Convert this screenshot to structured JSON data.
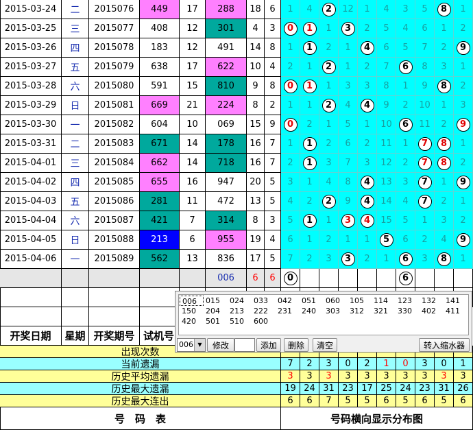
{
  "rows": [
    {
      "date": "2015-03-24",
      "wd": "二",
      "issue": "2015076",
      "trial": "449",
      "n1": "17",
      "draw": "288",
      "n2": "18",
      "n3": "6",
      "cells": [
        "1",
        "4",
        "2",
        "12",
        "1",
        "4",
        "3",
        "5",
        "8",
        "1"
      ],
      "balls": [
        2,
        8
      ]
    },
    {
      "date": "2015-03-25",
      "wd": "三",
      "issue": "2015077",
      "trial": "408",
      "n1": "12",
      "draw": "301",
      "n2": "4",
      "n3": "3",
      "cells": [
        "0",
        "1",
        "1",
        "3",
        "2",
        "5",
        "4",
        "6",
        "1",
        "2"
      ],
      "balls": [
        0,
        1,
        3
      ]
    },
    {
      "date": "2015-03-26",
      "wd": "四",
      "issue": "2015078",
      "trial": "183",
      "n1": "12",
      "draw": "491",
      "n2": "14",
      "n3": "8",
      "cells": [
        "1",
        "1",
        "2",
        "1",
        "4",
        "6",
        "5",
        "7",
        "2",
        "9"
      ],
      "balls": [
        1,
        4,
        9
      ]
    },
    {
      "date": "2015-03-27",
      "wd": "五",
      "issue": "2015079",
      "trial": "638",
      "n1": "17",
      "draw": "622",
      "n2": "10",
      "n3": "4",
      "cells": [
        "2",
        "1",
        "2",
        "1",
        "2",
        "7",
        "6",
        "8",
        "3",
        "1"
      ],
      "balls": [
        2,
        6
      ]
    },
    {
      "date": "2015-03-28",
      "wd": "六",
      "issue": "2015080",
      "trial": "591",
      "n1": "15",
      "draw": "810",
      "n2": "9",
      "n3": "8",
      "cells": [
        "0",
        "1",
        "1",
        "3",
        "3",
        "8",
        "1",
        "9",
        "8",
        "2"
      ],
      "balls": [
        0,
        1,
        8
      ]
    },
    {
      "date": "2015-03-29",
      "wd": "日",
      "issue": "2015081",
      "trial": "669",
      "n1": "21",
      "draw": "224",
      "n2": "8",
      "n3": "2",
      "cells": [
        "1",
        "1",
        "2",
        "4",
        "4",
        "9",
        "2",
        "10",
        "1",
        "3"
      ],
      "balls": [
        2,
        4
      ]
    },
    {
      "date": "2015-03-30",
      "wd": "一",
      "issue": "2015082",
      "trial": "604",
      "n1": "10",
      "draw": "069",
      "n2": "15",
      "n3": "9",
      "cells": [
        "0",
        "2",
        "1",
        "5",
        "1",
        "10",
        "6",
        "11",
        "2",
        "9"
      ],
      "balls": [
        0,
        6,
        9
      ]
    },
    {
      "date": "2015-03-31",
      "wd": "二",
      "issue": "2015083",
      "trial": "671",
      "n1": "14",
      "draw": "178",
      "n2": "16",
      "n3": "7",
      "cells": [
        "1",
        "1",
        "2",
        "6",
        "2",
        "11",
        "1",
        "7",
        "8",
        "1"
      ],
      "balls": [
        1,
        7,
        8
      ]
    },
    {
      "date": "2015-04-01",
      "wd": "三",
      "issue": "2015084",
      "trial": "662",
      "n1": "14",
      "draw": "718",
      "n2": "16",
      "n3": "7",
      "cells": [
        "2",
        "1",
        "3",
        "7",
        "3",
        "12",
        "2",
        "7",
        "8",
        "2"
      ],
      "balls": [
        1,
        7,
        8
      ]
    },
    {
      "date": "2015-04-02",
      "wd": "四",
      "issue": "2015085",
      "trial": "655",
      "n1": "16",
      "draw": "947",
      "n2": "20",
      "n3": "5",
      "cells": [
        "3",
        "1",
        "4",
        "8",
        "4",
        "13",
        "3",
        "7",
        "1",
        "9"
      ],
      "balls": [
        4,
        7,
        9
      ]
    },
    {
      "date": "2015-04-03",
      "wd": "五",
      "issue": "2015086",
      "trial": "281",
      "n1": "11",
      "draw": "472",
      "n2": "13",
      "n3": "5",
      "cells": [
        "4",
        "2",
        "2",
        "9",
        "4",
        "14",
        "4",
        "7",
        "2",
        "1"
      ],
      "balls": [
        2,
        4,
        7
      ]
    },
    {
      "date": "2015-04-04",
      "wd": "六",
      "issue": "2015087",
      "trial": "421",
      "n1": "7",
      "draw": "314",
      "n2": "8",
      "n3": "3",
      "cells": [
        "5",
        "1",
        "1",
        "3",
        "4",
        "15",
        "5",
        "1",
        "3",
        "2"
      ],
      "balls": [
        1,
        3,
        4
      ]
    },
    {
      "date": "2015-04-05",
      "wd": "日",
      "issue": "2015088",
      "trial": "213",
      "n1": "6",
      "draw": "955",
      "n2": "19",
      "n3": "4",
      "cells": [
        "6",
        "1",
        "2",
        "1",
        "1",
        "5",
        "6",
        "2",
        "4",
        "9"
      ],
      "balls": [
        5,
        9
      ]
    },
    {
      "date": "2015-04-06",
      "wd": "一",
      "issue": "2015089",
      "trial": "562",
      "n1": "13",
      "draw": "836",
      "n2": "17",
      "n3": "5",
      "cells": [
        "7",
        "2",
        "3",
        "3",
        "2",
        "1",
        "6",
        "3",
        "8",
        "1"
      ],
      "balls": [
        3,
        6,
        8
      ]
    }
  ],
  "trialStyles": [
    "magenta",
    "w",
    "w",
    "w",
    "w",
    "magenta",
    "w",
    "teal",
    "magenta",
    "magenta",
    "teal",
    "teal",
    "blue",
    "teal"
  ],
  "drawStyles": [
    "magenta",
    "teal",
    "w",
    "magenta",
    "teal",
    "magenta",
    "w",
    "teal",
    "teal",
    "w",
    "w",
    "teal",
    "magenta",
    "w"
  ],
  "redBalls": [
    [
      1,
      0
    ],
    [
      1,
      1
    ],
    [
      4,
      0
    ],
    [
      4,
      1
    ],
    [
      6,
      0
    ],
    [
      6,
      9
    ],
    [
      7,
      7
    ],
    [
      7,
      8
    ],
    [
      8,
      7
    ],
    [
      8,
      8
    ],
    [
      11,
      3
    ],
    [
      11,
      4
    ]
  ],
  "pending": {
    "draw": "006",
    "n2": "6",
    "n3": "6",
    "balls": [
      {
        "col": 0,
        "v": "0"
      },
      {
        "col": 6,
        "v": "6"
      }
    ]
  },
  "header": {
    "date": "开奖日期",
    "wd": "星期",
    "issue": "开奖期号",
    "trial": "试机号"
  },
  "stats": [
    {
      "label": "出现次数",
      "values": [
        "",
        "",
        "",
        "",
        "",
        "",
        "",
        "",
        "",
        ""
      ],
      "cls": "ylw"
    },
    {
      "label": "当前遗漏",
      "values": [
        "7",
        "2",
        "3",
        "0",
        "2",
        "1",
        "0",
        "3",
        "0",
        "1"
      ],
      "cls": "cyan2",
      "red": [
        5,
        6
      ]
    },
    {
      "label": "历史平均遗漏",
      "values": [
        "3",
        "3",
        "3",
        "3",
        "3",
        "3",
        "3",
        "3",
        "3",
        "3"
      ],
      "cls": "ylw",
      "red": [
        0,
        2,
        8
      ]
    },
    {
      "label": "历史最大遗漏",
      "values": [
        "19",
        "24",
        "31",
        "23",
        "17",
        "25",
        "24",
        "23",
        "31",
        "26"
      ],
      "cls": "cyan2"
    },
    {
      "label": "历史最大连出",
      "values": [
        "6",
        "6",
        "7",
        "5",
        "5",
        "6",
        "5",
        "6",
        "5",
        "6"
      ],
      "cls": "ylw"
    }
  ],
  "footer": {
    "left": "号　码　表",
    "right": "号码横向显示分布图"
  },
  "popup": {
    "codes": [
      "006",
      "015",
      "024",
      "033",
      "042",
      "051",
      "060",
      "105",
      "114",
      "123",
      "132",
      "141",
      "150",
      "204",
      "213",
      "222",
      "231",
      "240",
      "303",
      "312",
      "321",
      "330",
      "402",
      "411",
      "420",
      "501",
      "510",
      "600"
    ],
    "selected": "006",
    "modify": "修改",
    "add": "添加",
    "delete": "删除",
    "clear": "清空",
    "transfer": "转入缩水器"
  }
}
